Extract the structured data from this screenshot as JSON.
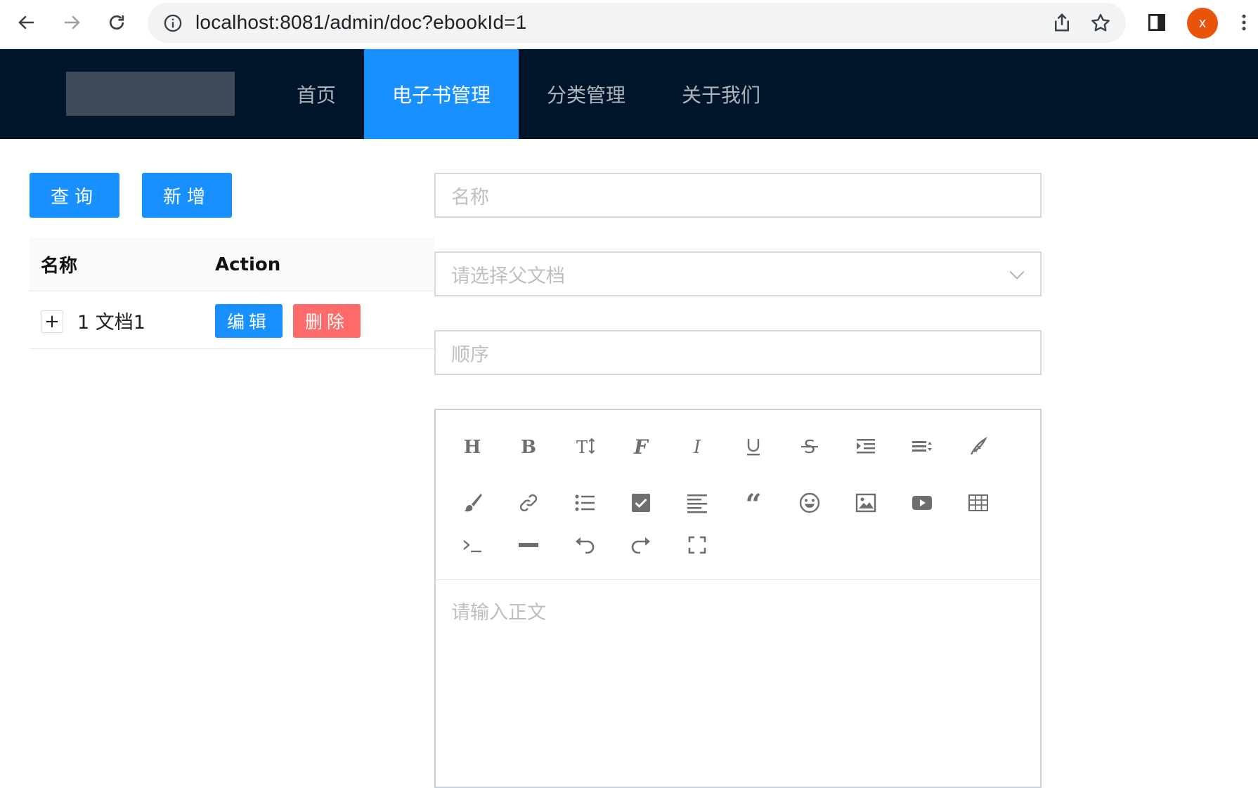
{
  "browser": {
    "url": "localhost:8081/admin/doc?ebookId=1",
    "profile_initial": "x",
    "accent": "#e8540b"
  },
  "nav": {
    "items": [
      {
        "label": "首页",
        "active": false
      },
      {
        "label": "电子书管理",
        "active": true
      },
      {
        "label": "分类管理",
        "active": false
      },
      {
        "label": "关于我们",
        "active": false
      }
    ],
    "background": "#001529",
    "active_color": "#1890ff"
  },
  "actions": {
    "query_label": "查询",
    "add_label": "新增"
  },
  "table": {
    "columns": [
      "名称",
      "Action"
    ],
    "rows": [
      {
        "expand": "+",
        "name": "1 文档1",
        "edit_label": "编辑",
        "delete_label": "删除"
      }
    ]
  },
  "form": {
    "name_placeholder": "名称",
    "parent_placeholder": "请选择父文档",
    "sort_placeholder": "顺序",
    "content_placeholder": "请输入正文"
  },
  "editor_toolbar": [
    "heading-icon",
    "bold-icon",
    "font-size-icon",
    "font-family-icon",
    "italic-icon",
    "underline-icon",
    "strikethrough-icon",
    "indent-icon",
    "line-height-icon",
    "font-color-icon",
    "background-color-icon",
    "link-icon",
    "list-icon",
    "todo-icon",
    "justify-icon",
    "quote-icon",
    "emoticon-icon",
    "image-icon",
    "video-icon",
    "table-icon",
    "code-icon",
    "divider-icon",
    "undo-icon",
    "redo-icon",
    "fullscreen-icon"
  ]
}
